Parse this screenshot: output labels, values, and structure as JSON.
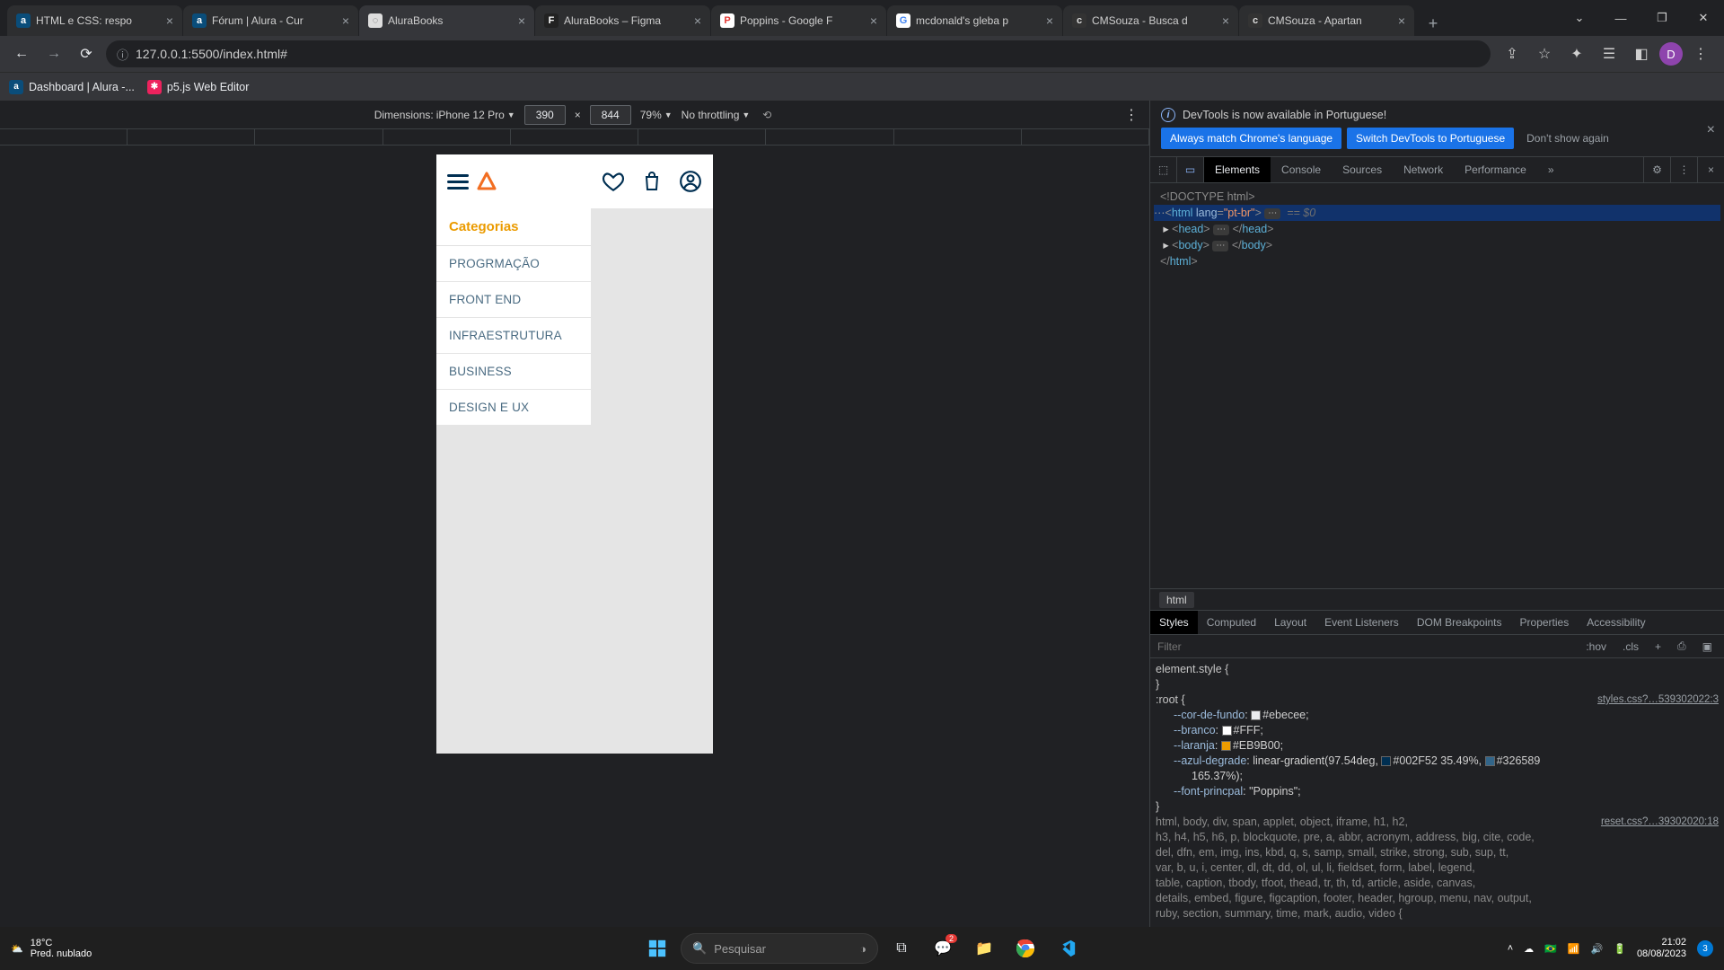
{
  "tabs": [
    {
      "fav_bg": "#0a4d7a",
      "fav_fg": "#fff",
      "fav": "a",
      "title": "HTML e CSS: respo"
    },
    {
      "fav_bg": "#0a4d7a",
      "fav_fg": "#fff",
      "fav": "a",
      "title": "Fórum | Alura - Cur"
    },
    {
      "fav_bg": "#ddd",
      "fav_fg": "#555",
      "fav": "◌",
      "title": "AluraBooks",
      "active": true
    },
    {
      "fav_bg": "#222",
      "fav_fg": "#fff",
      "fav": "F",
      "title": "AluraBooks – Figma"
    },
    {
      "fav_bg": "#fff",
      "fav_fg": "#e53935",
      "fav": "P",
      "title": "Poppins - Google F"
    },
    {
      "fav_bg": "#fff",
      "fav_fg": "#4285f4",
      "fav": "G",
      "title": "mcdonald's gleba p"
    },
    {
      "fav_bg": "#333",
      "fav_fg": "#ddd",
      "fav": "c",
      "title": "CMSouza - Busca d"
    },
    {
      "fav_bg": "#333",
      "fav_fg": "#ddd",
      "fav": "c",
      "title": "CMSouza - Apartan"
    }
  ],
  "omnibox": {
    "info_glyph": "ⓘ",
    "url": "127.0.0.1:5500/index.html#",
    "avatar_letter": "D"
  },
  "bookmarks": [
    {
      "fav_bg": "#0a4d7a",
      "fav_fg": "#fff",
      "fav": "a",
      "label": "Dashboard | Alura -..."
    },
    {
      "fav_bg": "#ed225d",
      "fav_fg": "#fff",
      "fav": "✱",
      "label": "p5.js Web Editor"
    }
  ],
  "device_toolbar": {
    "dimensions_label": "Dimensions:",
    "device": "iPhone 12 Pro",
    "w": "390",
    "x": "×",
    "h": "844",
    "zoom": "79%",
    "throttling": "No throttling"
  },
  "app": {
    "categories_header": "Categorias",
    "items": [
      "PROGRMAÇÃO",
      "FRONT END",
      "INFRAESTRUTURA",
      "BUSINESS",
      "DESIGN E UX"
    ]
  },
  "devtools": {
    "banner": "DevTools is now available in Portuguese!",
    "btn1": "Always match Chrome's language",
    "btn2": "Switch DevTools to Portuguese",
    "btn3": "Don't show again",
    "tabs": [
      "Elements",
      "Console",
      "Sources",
      "Network",
      "Performance"
    ],
    "active_tab": "Elements",
    "dom": {
      "doctype": "<!DOCTYPE html>",
      "html_open_pre": "<html ",
      "html_attr": "lang",
      "html_val": "\"pt-br\"",
      "html_open_post": ">",
      "eq": "== $0",
      "head": "<head>",
      "head_close": "</head>",
      "body": "<body>",
      "body_close": "</body>",
      "html_close": "</html>"
    },
    "crumb": "html",
    "subtabs": [
      "Styles",
      "Computed",
      "Layout",
      "Event Listeners",
      "DOM Breakpoints",
      "Properties",
      "Accessibility"
    ],
    "filter_placeholder": "Filter",
    "hov": ":hov",
    "cls": ".cls",
    "styles": {
      "elstyle": "element.style {",
      "brace_close": "}",
      "root": ":root {",
      "root_src": "styles.css?…539302022:3",
      "p1": {
        "n": "--cor-de-fundo",
        "v": "#ebecee",
        "sw": "#ebecee"
      },
      "p2": {
        "n": "--branco",
        "v": "#FFF",
        "sw": "#FFFFFF"
      },
      "p3": {
        "n": "--laranja",
        "v": "#EB9B00",
        "sw": "#EB9B00"
      },
      "p4": {
        "n": "--azul-degrade",
        "v": "linear-gradient(97.54deg,",
        "sw1": "#002F52",
        "mid": "#002F52 35.49%,",
        "sw2": "#326589",
        "end": "#326589"
      },
      "p4b": "165.37%);",
      "p5": {
        "n": "--font-princpal",
        "v": "\"Poppins\""
      },
      "reset_src": "reset.css?…39302020:18",
      "reset_selectors": "html, body, div, span, applet, object, iframe, h1, h2,",
      "reset_line2": "h3, h4, h5, h6, p, blockquote, pre, a, abbr, acronym, address, big, cite, code,",
      "reset_line3": "del, dfn, em, img, ins, kbd, q, s, samp, small, strike, strong, sub, sup, tt,",
      "reset_line4": "var, b, u, i, center, dl, dt, dd, ol, ul, li, fieldset, form, label, legend,",
      "reset_line5": "table, caption, tbody, tfoot, thead, tr, th, td, article, aside, canvas,",
      "reset_line6": "details, embed, figure, figcaption, footer, header, hgroup, menu, nav, output,",
      "reset_line7": "ruby, section, summary, time, mark, audio, video {"
    }
  },
  "taskbar": {
    "temp": "18°C",
    "cond": "Pred. nublado",
    "search_placeholder": "Pesquisar",
    "time": "21:02",
    "date": "08/08/2023",
    "notif": "3"
  }
}
